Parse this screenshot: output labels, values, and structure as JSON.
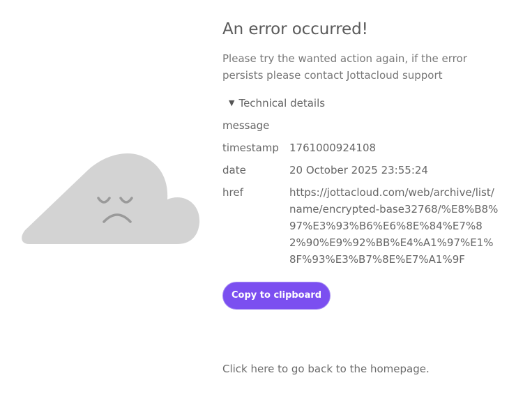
{
  "error": {
    "title": "An error occurred!",
    "message": "Please try the wanted action again, if the error persists please contact Jottacloud support"
  },
  "details": {
    "summary_label": "Technical details",
    "rows": [
      {
        "key": "message",
        "value": ""
      },
      {
        "key": "timestamp",
        "value": "1761000924108"
      },
      {
        "key": "date",
        "value": "20 October 2025 23:55:24"
      },
      {
        "key": "href",
        "value": "https://jottacloud.com/web/archive/list/name/encrypted-base32768/%E8%B8%97%E3%93%B6%E6%8E%84%E7%82%90%E9%92%BB%E4%A1%97%E1%8F%93%E3%B7%8E%E7%A1%9F"
      }
    ]
  },
  "actions": {
    "copy_label": "Copy to clipboard",
    "home_link": "Click here to go back to the homepage."
  },
  "colors": {
    "accent": "#7b4ff0",
    "cloud": "#d3d3d3",
    "face": "#9a9a9a"
  },
  "icons": {
    "illustration": "sad-cloud-icon",
    "disclosure": "triangle-down-icon"
  }
}
